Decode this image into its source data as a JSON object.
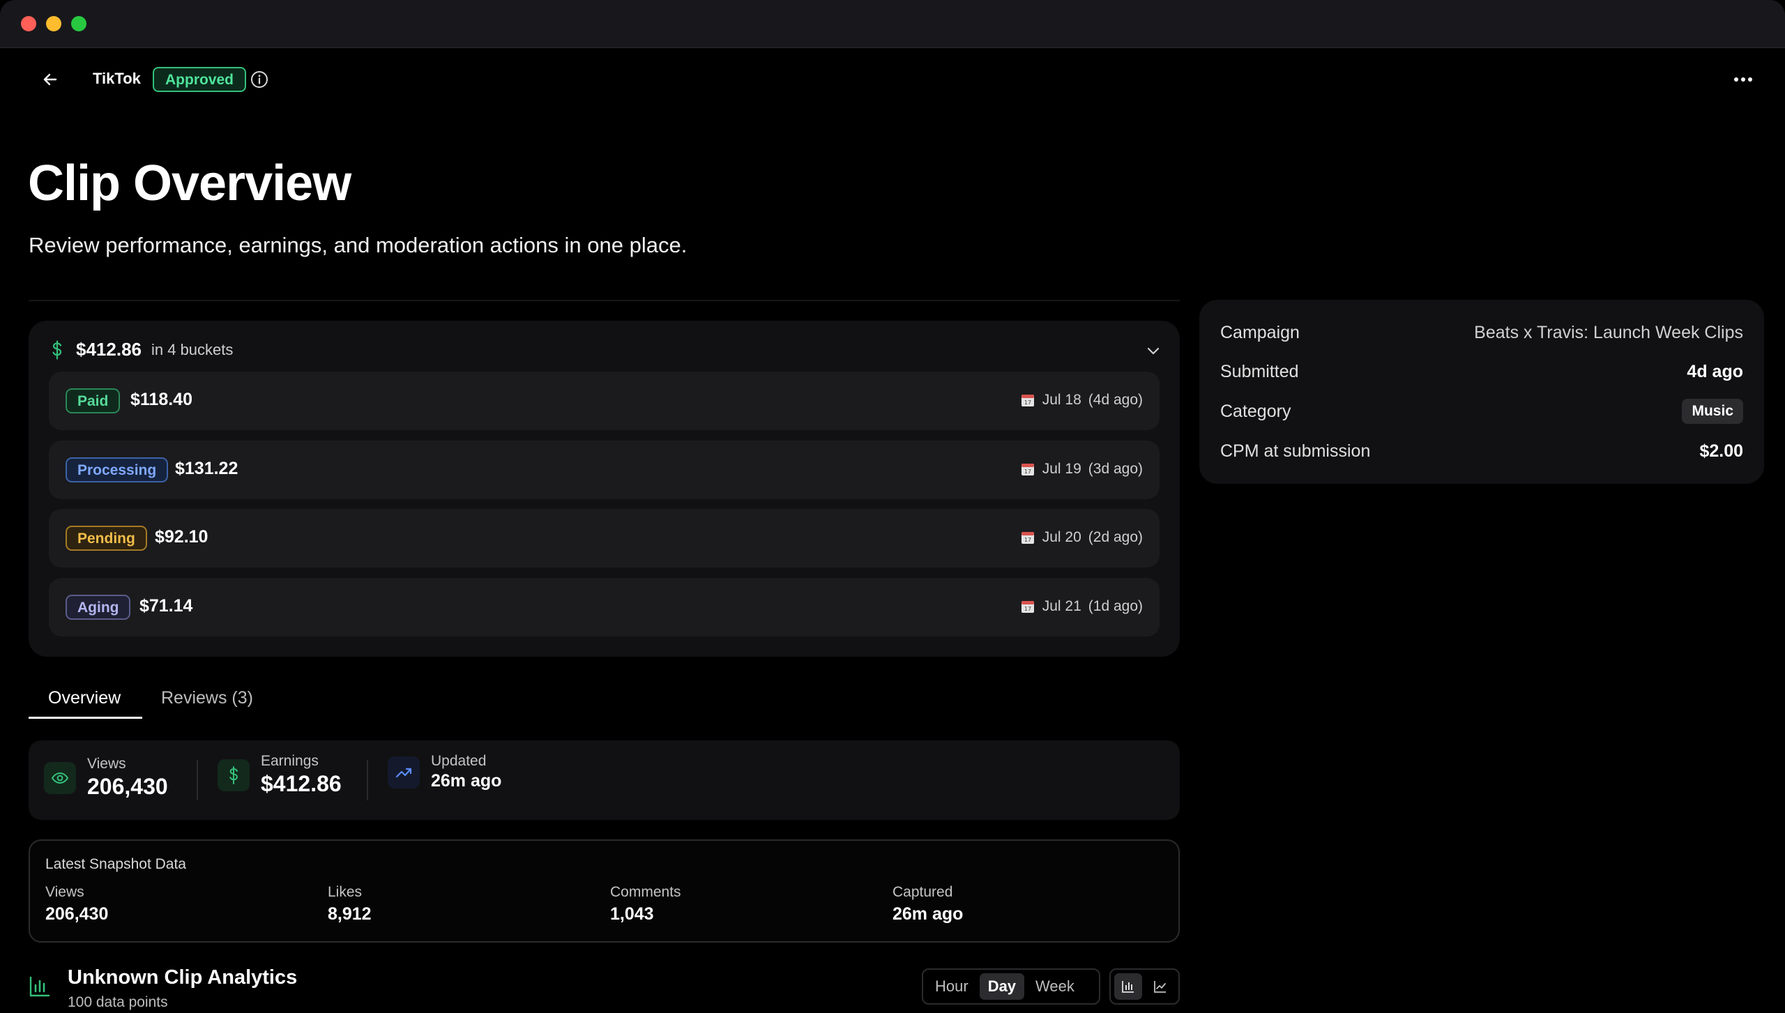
{
  "header": {
    "platform": "TikTok",
    "status": "Approved"
  },
  "page": {
    "title": "Clip Overview",
    "subtitle": "Review performance, earnings, and moderation actions in one place."
  },
  "earnings": {
    "total": "$412.86",
    "buckets_label": "in 4 buckets",
    "buckets": [
      {
        "status": "Paid",
        "amount": "$118.40",
        "date": "Jul 18",
        "ago": "(4d ago)"
      },
      {
        "status": "Processing",
        "amount": "$131.22",
        "date": "Jul 19",
        "ago": "(3d ago)"
      },
      {
        "status": "Pending",
        "amount": "$92.10",
        "date": "Jul 20",
        "ago": "(2d ago)"
      },
      {
        "status": "Aging",
        "amount": "$71.14",
        "date": "Jul 21",
        "ago": "(1d ago)"
      }
    ]
  },
  "info": {
    "campaign_label": "Campaign",
    "campaign_value": "Beats x Travis: Launch Week Clips",
    "submitted_label": "Submitted",
    "submitted_value": "4d ago",
    "category_label": "Category",
    "category_value": "Music",
    "cpm_label": "CPM at submission",
    "cpm_value": "$2.00"
  },
  "tabs": [
    {
      "label": "Overview",
      "active": true
    },
    {
      "label": "Reviews (3)",
      "active": false
    }
  ],
  "stats": {
    "views_label": "Views",
    "views_value": "206,430",
    "earnings_label": "Earnings",
    "earnings_value": "$412.86",
    "updated_label": "Updated",
    "updated_value": "26m ago"
  },
  "snapshot": {
    "title": "Latest Snapshot Data",
    "columns": [
      {
        "label": "Views",
        "value": "206,430"
      },
      {
        "label": "Likes",
        "value": "8,912"
      },
      {
        "label": "Comments",
        "value": "1,043"
      },
      {
        "label": "Captured",
        "value": "26m ago"
      }
    ]
  },
  "analytics": {
    "title": "Unknown Clip Analytics",
    "subtitle": "100 data points",
    "ranges": [
      "Hour",
      "Day",
      "Week"
    ],
    "active_range": "Day",
    "chart_modes": [
      "bar-chart-icon",
      "line-chart-icon"
    ],
    "active_mode": "bar-chart-icon"
  },
  "colors": {
    "accent_green": "#34c07b",
    "processing_blue": "#7fa8ff",
    "pending_amber": "#f3bd4a",
    "aging_violet": "#b4b6f0"
  }
}
